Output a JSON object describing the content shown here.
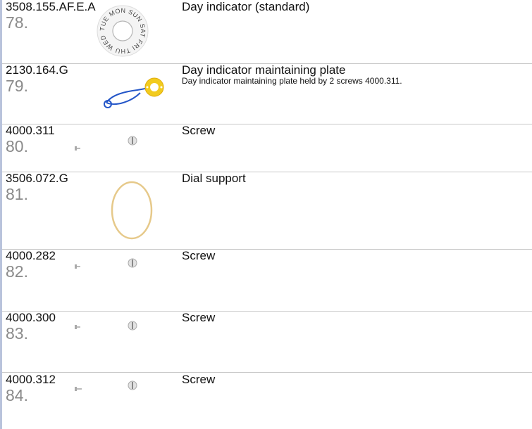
{
  "parts": [
    {
      "ref": "3508.155.AF.E.A",
      "num": "78.",
      "title": "Day indicator (standard)",
      "desc": "",
      "icon": "day-indicator-disc",
      "disc_text": "TUE MON SUN SAT FRI THU WED"
    },
    {
      "ref": "2130.164.G",
      "num": "79.",
      "title": "Day indicator maintaining plate",
      "desc": "Day indicator maintaining plate held by 2 screws 4000.311.",
      "icon": "maintaining-plate"
    },
    {
      "ref": "4000.311",
      "num": "80.",
      "title": "Screw",
      "desc": "",
      "icon": "screw"
    },
    {
      "ref": "3506.072.G",
      "num": "81.",
      "title": "Dial support",
      "desc": "",
      "icon": "dial-support-ring"
    },
    {
      "ref": "4000.282",
      "num": "82.",
      "title": "Screw",
      "desc": "",
      "icon": "screw"
    },
    {
      "ref": "4000.300",
      "num": "83.",
      "title": "Screw",
      "desc": "",
      "icon": "screw"
    },
    {
      "ref": "4000.312",
      "num": "84.",
      "title": "Screw",
      "desc": "",
      "icon": "screw"
    }
  ],
  "colors": {
    "plate_gold": "#f2cb1e",
    "plate_blue": "#2456c8",
    "ring_gold": "#e6c98a",
    "left_bar": "#b9c3dc",
    "separator": "#c8c8c8"
  }
}
